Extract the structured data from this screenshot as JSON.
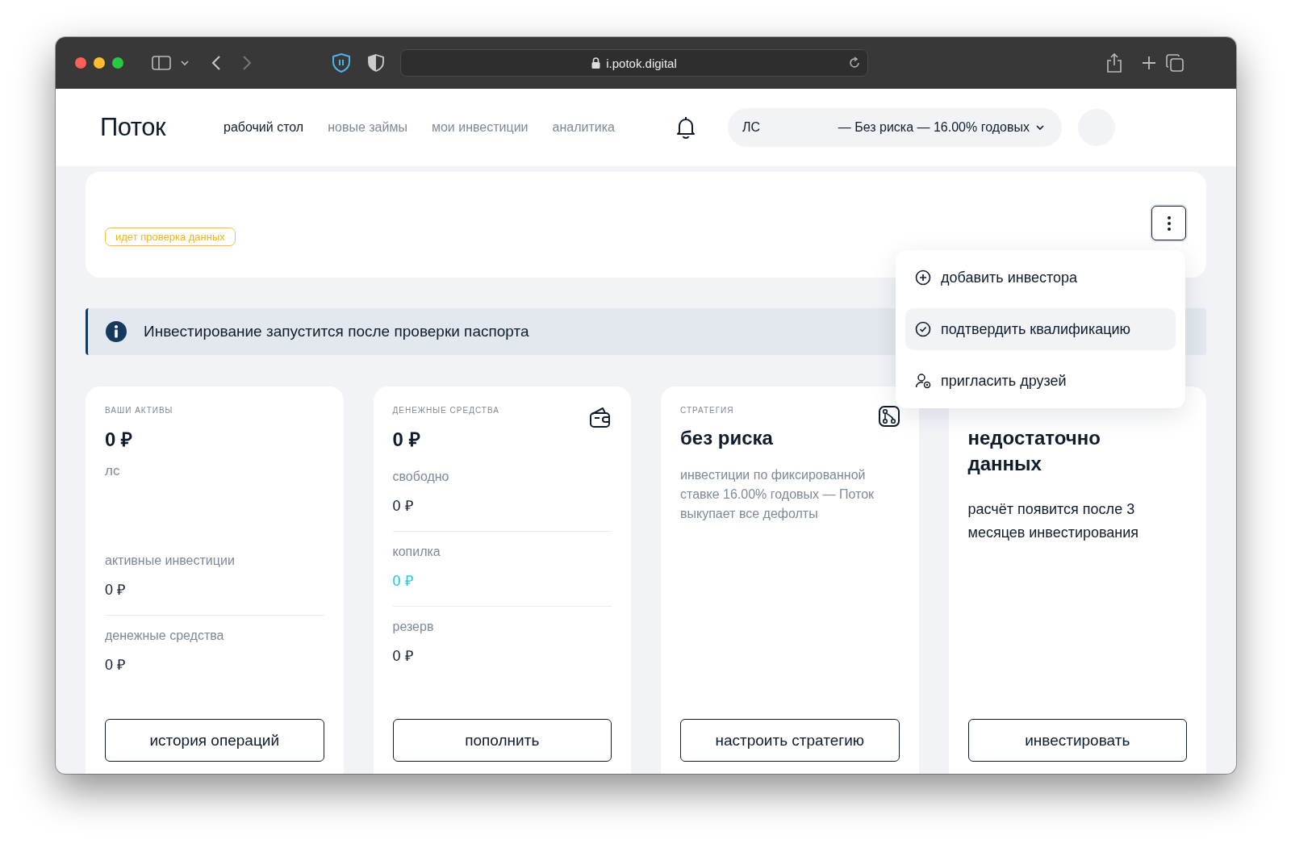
{
  "browser": {
    "url": "i.potok.digital"
  },
  "header": {
    "logo": "Поток",
    "nav": [
      {
        "label": "рабочий стол",
        "selected": true
      },
      {
        "label": "новые займы",
        "selected": false
      },
      {
        "label": "мои инвестиции",
        "selected": false
      },
      {
        "label": "аналитика",
        "selected": false
      }
    ],
    "account": {
      "label": "ЛС",
      "strategy": "— Без риска — 16.00% годовых"
    }
  },
  "status_card": {
    "badge": "идет проверка данных",
    "menu_expanded": true
  },
  "menu": [
    {
      "label": "добавить инвестора",
      "selected": false,
      "kind": "add"
    },
    {
      "label": "подтвердить квалификацию",
      "selected": true,
      "kind": "confirm"
    },
    {
      "label": "пригласить друзей",
      "selected": false,
      "kind": "invite"
    }
  ],
  "notice": "Инвестирование запустится после проверки паспорта",
  "cards": [
    {
      "kind": "assets",
      "label": "ВАШИ АКТИВЫ",
      "amount": "0 ₽",
      "subtitle": "лс",
      "rows": [
        {
          "label": "активные инвестиции",
          "value": "0 ₽",
          "color": "#0f1c2d"
        },
        {
          "label": "денежные средства",
          "value": "0 ₽",
          "color": "#0f1c2d"
        }
      ],
      "button": "история операций"
    },
    {
      "kind": "cash",
      "label": "ДЕНЕЖНЫЕ СРЕДСТВА",
      "amount": "0 ₽",
      "rows": [
        {
          "label": "свободно",
          "value": "0 ₽",
          "color": "#0f1c2d"
        },
        {
          "label": "копилка",
          "value": "0 ₽",
          "color": "#22c6d8"
        },
        {
          "label": "резерв",
          "value": "0 ₽",
          "color": "#0f1c2d"
        }
      ],
      "button": "пополнить"
    },
    {
      "kind": "strategy",
      "label": "СТРАТЕГИЯ",
      "title": "без риска",
      "description": "инвестиции по фиксированной ставке 16.00% годовых — Поток выкупает все дефолты",
      "button": "настроить стратегию"
    },
    {
      "kind": "forecast",
      "title": "недостаточно данных",
      "description": "расчёт появится после 3 месяцев инвестирования",
      "button": "инвестировать"
    }
  ]
}
